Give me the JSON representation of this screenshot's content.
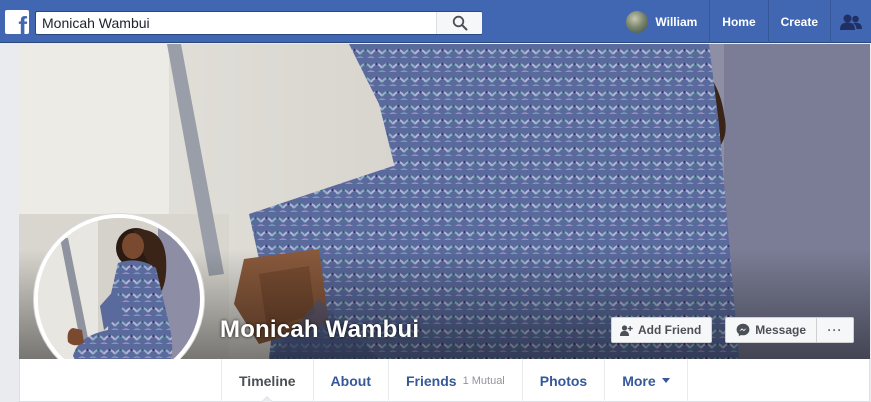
{
  "topbar": {
    "logo": "f",
    "search": {
      "value": "Monicah Wambui",
      "icon": "search-icon"
    },
    "user_name": "William",
    "nav_home": "Home",
    "nav_create": "Create",
    "friends_icon": "friend-requests-icon"
  },
  "profile": {
    "name": "Monicah Wambui",
    "add_friend_label": "Add Friend",
    "message_label": "Message",
    "more_label": "···"
  },
  "tabs": {
    "timeline": "Timeline",
    "about": "About",
    "friends": "Friends",
    "friends_mutual": "1 Mutual",
    "photos": "Photos",
    "more": "More"
  },
  "colors": {
    "brand_blue": "#4267b2",
    "link_blue": "#365899",
    "page_bg": "#e9ebee"
  }
}
